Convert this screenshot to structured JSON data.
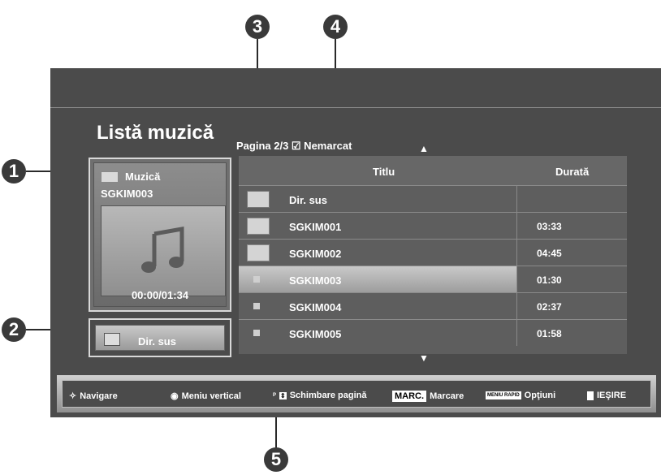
{
  "callouts": [
    "1",
    "2",
    "3",
    "4",
    "5"
  ],
  "screen": {
    "title": "Listă muzică",
    "page_info": "Pagina 2/3 ☑ Nemarcat",
    "arrow_up": "▲",
    "arrow_down": "▼"
  },
  "now_playing": {
    "label": "Muzică",
    "name": "SGKIM003",
    "time": "00:00/01:34",
    "icons": [
      "folder-icon",
      "music-note-icon"
    ]
  },
  "dir_up_button": {
    "label": "Dir. sus",
    "icon": "folder-up-icon"
  },
  "table": {
    "columns": [
      "Titlu",
      "Durată"
    ],
    "rows": [
      {
        "icon": "folder-up-icon",
        "name": "Dir. sus",
        "duration": ""
      },
      {
        "icon": "folder-icon",
        "name": "SGKIM001",
        "duration": "03:33"
      },
      {
        "icon": "folder-icon",
        "name": "SGKIM002",
        "duration": "04:45"
      },
      {
        "icon": "file-icon",
        "name": "SGKIM003",
        "duration": "01:30",
        "selected": true
      },
      {
        "icon": "file-icon",
        "name": "SGKIM004",
        "duration": "02:37"
      },
      {
        "icon": "file-icon",
        "name": "SGKIM005",
        "duration": "01:58"
      }
    ]
  },
  "footer": {
    "navigate": "Navigare",
    "vertical_menu": "Meniu vertical",
    "p_label": "P",
    "page_change": "Schimbare pagină",
    "marc_badge": "MARC.",
    "mark": "Marcare",
    "quick_menu_badge": "MENIU RAPID",
    "options": "Opţiuni",
    "exit": "IEŞIRE"
  }
}
